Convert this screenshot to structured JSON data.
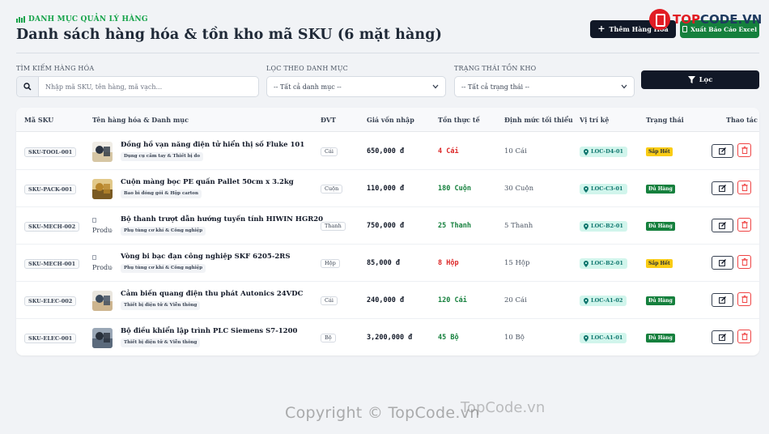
{
  "header": {
    "breadcrumb": "DANH MỤC QUẢN LÝ HÀNG",
    "title": "Danh sách hàng hóa & tồn kho mã SKU (6 mặt hàng)",
    "add_button": "Thêm Hàng Hóa",
    "export_button": "Xuất Báo Cáo Excel",
    "logo_text_red": "TOP",
    "logo_text": "CODE.VN"
  },
  "filters": {
    "search_label": "TÌM KIẾM HÀNG HÓA",
    "search_placeholder": "Nhập mã SKU, tên hàng, mã vạch...",
    "category_label": "LỌC THEO DANH MỤC",
    "category_value": "-- Tất cả danh mục --",
    "status_label": "TRẠNG THÁI TỒN KHO",
    "status_value": "-- Tất cả trạng thái --",
    "filter_button": "Lọc"
  },
  "table": {
    "columns": [
      "Mã SKU",
      "Tên hàng hóa & Danh mục",
      "ĐVT",
      "Giá vốn nhập",
      "Tồn thực tế",
      "Định mức tối thiểu",
      "Vị trí kệ",
      "Trạng thái",
      "Thao tác"
    ],
    "rows": [
      {
        "sku": "SKU-TOOL-001",
        "name": "Đồng hồ vạn năng điện tử hiển thị số Fluke 101",
        "category": "Dụng cụ cầm tay & Thiết bị đo",
        "unit": "Cái",
        "cost": "650,000 đ",
        "stock": "4 Cái",
        "stock_state": "low",
        "min": "10 Cái",
        "location": "LOC-D4-01",
        "status": "Sắp Hết",
        "status_state": "warn",
        "image": "photo",
        "image_alt": ""
      },
      {
        "sku": "SKU-PACK-001",
        "name": "Cuộn màng bọc PE quấn Pallet 50cm x 3.2kg",
        "category": "Bao bì đóng gói & Hộp carton",
        "unit": "Cuộn",
        "cost": "110,000 đ",
        "stock": "180 Cuộn",
        "stock_state": "ok",
        "min": "30 Cuộn",
        "location": "LOC-C3-01",
        "status": "Đủ Hàng",
        "status_state": "good",
        "image": "photo",
        "image_alt": ""
      },
      {
        "sku": "SKU-MECH-002",
        "name": "Bộ thanh trượt dẫn hướng tuyến tính HIWIN HGR20",
        "category": "Phụ tùng cơ khí & Công nghiệp",
        "unit": "Thanh",
        "cost": "750,000 đ",
        "stock": "25 Thanh",
        "stock_state": "ok",
        "min": "5 Thanh",
        "location": "LOC-B2-01",
        "status": "Đủ Hàng",
        "status_state": "good",
        "image": "broken",
        "image_alt": "Product"
      },
      {
        "sku": "SKU-MECH-001",
        "name": "Vòng bi bạc đạn công nghiệp SKF 6205-2RS",
        "category": "Phụ tùng cơ khí & Công nghiệp",
        "unit": "Hộp",
        "cost": "85,000 đ",
        "stock": "8 Hộp",
        "stock_state": "low",
        "min": "15 Hộp",
        "location": "LOC-B2-01",
        "status": "Sắp Hết",
        "status_state": "warn",
        "image": "broken",
        "image_alt": "Product"
      },
      {
        "sku": "SKU-ELEC-002",
        "name": "Cảm biến quang điện thu phát Autonics 24VDC",
        "category": "Thiết bị điện tử & Viễn thông",
        "unit": "Cái",
        "cost": "240,000 đ",
        "stock": "120 Cái",
        "stock_state": "ok",
        "min": "20 Cái",
        "location": "LOC-A1-02",
        "status": "Đủ Hàng",
        "status_state": "good",
        "image": "photo",
        "image_alt": ""
      },
      {
        "sku": "SKU-ELEC-001",
        "name": "Bộ điều khiển lập trình PLC Siemens S7-1200",
        "category": "Thiết bị điện tử & Viễn thông",
        "unit": "Bộ",
        "cost": "3,200,000 đ",
        "stock": "45 Bộ",
        "stock_state": "ok",
        "min": "10 Bộ",
        "location": "LOC-A1-01",
        "status": "Đủ Hàng",
        "status_state": "good",
        "image": "photo",
        "image_alt": ""
      }
    ]
  },
  "watermark": {
    "main": "Copyright © TopCode.vn",
    "secondary": "TopCode.vn"
  },
  "colors": {
    "accent_dark": "#111827",
    "accent_green": "#15803d",
    "danger": "#dc2626",
    "warning": "#facc15",
    "location_bg": "#d1f5ec"
  }
}
